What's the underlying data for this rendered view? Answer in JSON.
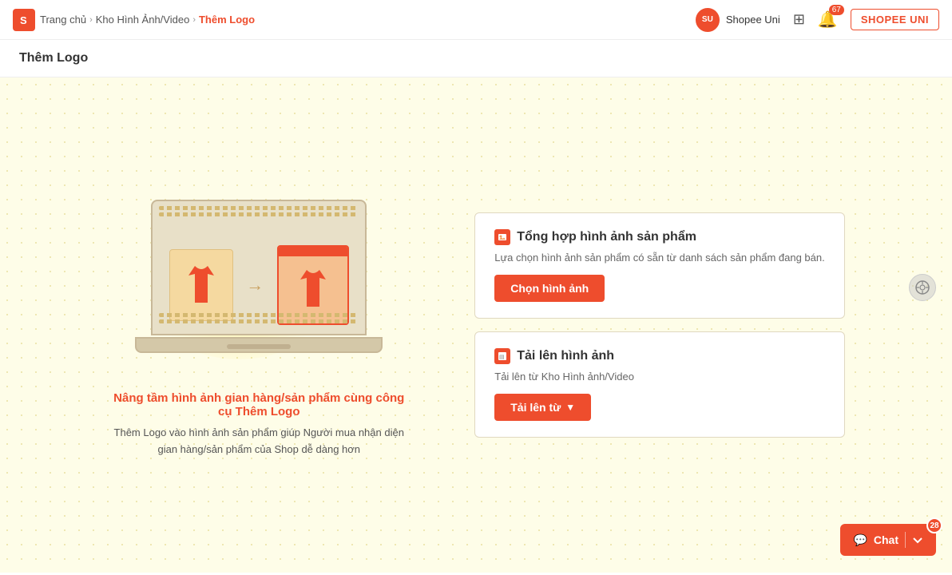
{
  "header": {
    "logo_label": "S",
    "breadcrumb": [
      {
        "label": "Trang chủ",
        "active": false
      },
      {
        "label": "Kho Hình Ảnh/Video",
        "active": false
      },
      {
        "label": "Thêm Logo",
        "active": true
      }
    ],
    "shopee_uni_label": "Shopee Uni",
    "notif_count": "67",
    "shopee_uni_btn": "SHOPEE UNI"
  },
  "page": {
    "title": "Thêm Logo"
  },
  "illustration": {
    "caption_title": "Nâng tầm hình ảnh gian hàng/sản phẩm cùng công cụ Thêm Logo",
    "caption_desc": "Thêm Logo vào hình ảnh sản phẩm giúp Người mua nhận diện gian hàng/sản phẩm của Shop dễ dàng hơn"
  },
  "options": [
    {
      "icon": "🖼",
      "title": "Tổng hợp hình ảnh sản phẩm",
      "desc": "Lựa chọn hình ảnh sản phẩm có sẵn từ danh sách sản phẩm đang bán.",
      "btn_label": "Chọn hình ảnh"
    },
    {
      "icon": "🖼",
      "title": "Tải lên hình ảnh",
      "desc": "Tải lên từ Kho Hình ảnh/Video",
      "btn_label": "Tải lên từ",
      "btn_dropdown": true
    }
  ],
  "chat": {
    "label": "Chat",
    "badge": "28"
  }
}
